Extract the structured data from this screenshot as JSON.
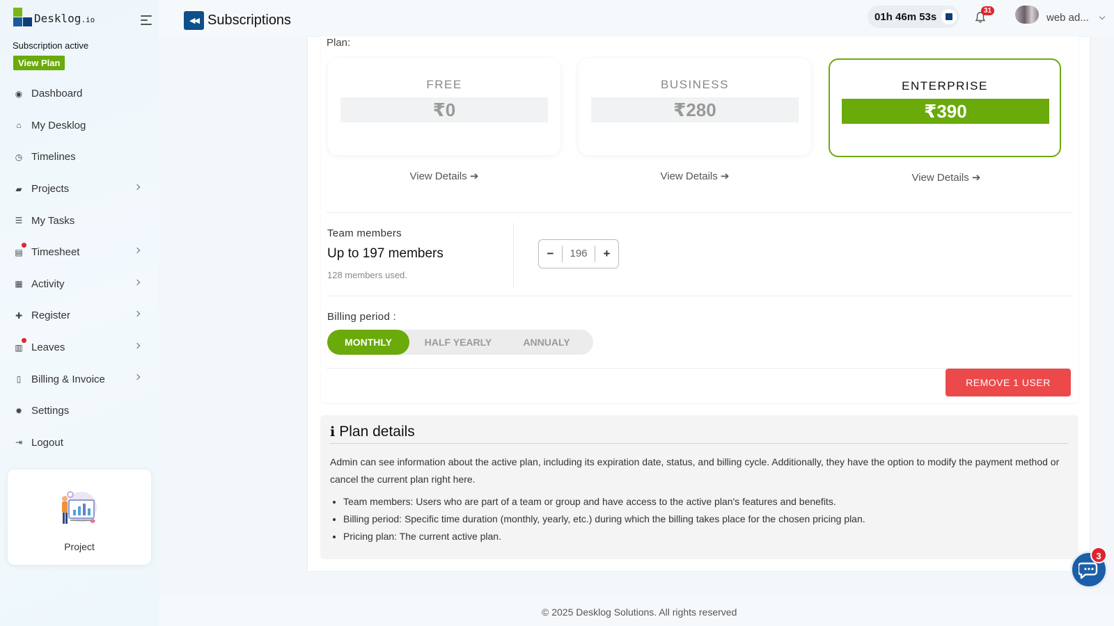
{
  "brand": {
    "name": "Desklog",
    "suffix": ".io",
    "colors": {
      "accent": "#6aaa0a",
      "navy": "#0f4f8a",
      "danger": "#ec4a4a"
    }
  },
  "sidebar": {
    "subscription_status": "Subscription active",
    "view_plan_label": "View Plan",
    "items": [
      {
        "label": "Dashboard",
        "icon": "dashboard-icon",
        "glyph": "◉",
        "has_submenu": false,
        "dot": false
      },
      {
        "label": "My Desklog",
        "icon": "home-icon",
        "glyph": "⌂",
        "has_submenu": false,
        "dot": false
      },
      {
        "label": "Timelines",
        "icon": "clock-icon",
        "glyph": "◷",
        "has_submenu": false,
        "dot": false
      },
      {
        "label": "Projects",
        "icon": "book-icon",
        "glyph": "▰",
        "has_submenu": true,
        "dot": false
      },
      {
        "label": "My Tasks",
        "icon": "tasks-icon",
        "glyph": "☰",
        "has_submenu": false,
        "dot": false
      },
      {
        "label": "Timesheet",
        "icon": "timesheet-icon",
        "glyph": "▤",
        "has_submenu": true,
        "dot": true
      },
      {
        "label": "Activity",
        "icon": "grid-icon",
        "glyph": "▦",
        "has_submenu": true,
        "dot": false
      },
      {
        "label": "Register",
        "icon": "plus-icon",
        "glyph": "✚",
        "has_submenu": true,
        "dot": false
      },
      {
        "label": "Leaves",
        "icon": "calendar-icon",
        "glyph": "▥",
        "has_submenu": true,
        "dot": true
      },
      {
        "label": "Billing & Invoice",
        "icon": "invoice-icon",
        "glyph": "▯",
        "has_submenu": true,
        "dot": false
      },
      {
        "label": "Settings",
        "icon": "gear-icon",
        "glyph": "✹",
        "has_submenu": false,
        "dot": false
      },
      {
        "label": "Logout",
        "icon": "logout-icon",
        "glyph": "⇥",
        "has_submenu": false,
        "dot": false
      }
    ],
    "project_card_label": "Project"
  },
  "header": {
    "title": "Subscriptions",
    "timer": "01h 46m 53s",
    "notification_count": "31",
    "user_name": "web ad..."
  },
  "plans": {
    "label": "Plan:",
    "items": [
      {
        "name": "FREE",
        "price": "₹0",
        "details_label": "View Details ➔",
        "active": false
      },
      {
        "name": "BUSINESS",
        "price": "₹280",
        "details_label": "View Details ➔",
        "active": false
      },
      {
        "name": "ENTERPRISE",
        "price": "₹390",
        "details_label": "View Details ➔",
        "active": true
      }
    ]
  },
  "team": {
    "label": "Team members",
    "value": "Up to 197 members",
    "used": "128 members used.",
    "stepper_value": "196",
    "minus": "−",
    "plus": "+"
  },
  "billing": {
    "label": "Billing period :",
    "options": [
      "MONTHLY",
      "HALF YEARLY",
      "ANNUALY"
    ],
    "selected": "MONTHLY"
  },
  "remove_button": "REMOVE 1 USER",
  "plan_details": {
    "title": "Plan details",
    "description": "Admin can see information about the active plan, including its expiration date, status, and billing cycle. Additionally, they have the option to modify the payment method or cancel the current plan right here.",
    "bullets": [
      "Team members: Users who are part of a team or group and have access to the active plan's features and benefits.",
      "Billing period: Specific time duration (monthly, yearly, etc.) during which the billing takes place for the chosen pricing plan.",
      "Pricing plan: The current active plan."
    ]
  },
  "footer": "© 2025 Desklog Solutions. All rights reserved",
  "chat_badge": "3"
}
